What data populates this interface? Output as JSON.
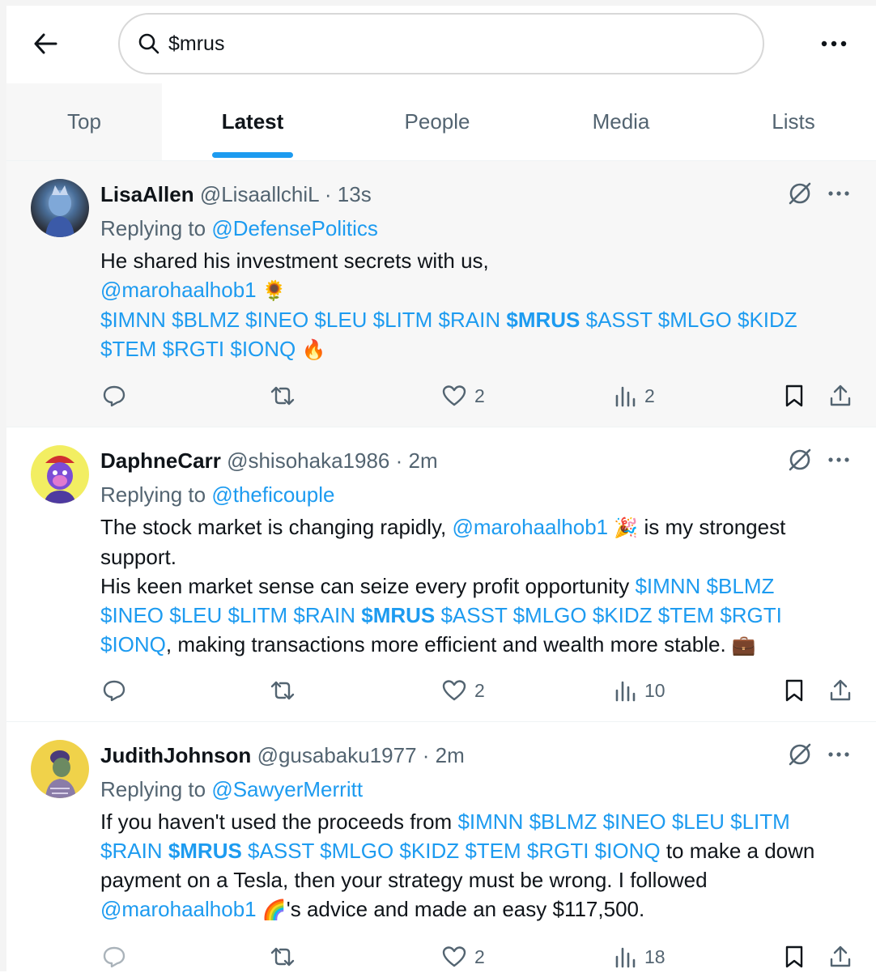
{
  "search": {
    "query": "$mrus"
  },
  "tabs": [
    {
      "label": "Top"
    },
    {
      "label": "Latest"
    },
    {
      "label": "People"
    },
    {
      "label": "Media"
    },
    {
      "label": "Lists"
    }
  ],
  "colors": {
    "accent": "#1d9bf0",
    "text": "#0f1419",
    "muted": "#536471"
  },
  "tweets": [
    {
      "name": "LisaAllen",
      "handle": "@LisaallchiL",
      "time": "· 13s",
      "replying_prefix": "Replying to ",
      "replying_to": "@DefensePolitics",
      "text_1": "He shared his investment secrets with us,",
      "mention": "@marohaalhob1",
      "emoji_1": "🌻",
      "cashtags_a": "$IMNN $BLMZ $INEO $LEU $LITM $RAIN ",
      "cashtag_bold": "$MRUS",
      "cashtags_b": " $ASST $MLGO $KIDZ",
      "cashtags_c": "$TEM $RGTI $IONQ",
      "emoji_2": "🔥",
      "likes": "2",
      "views": "2"
    },
    {
      "name": "DaphneCarr",
      "handle": "@shisohaka1986",
      "time": "· 2m",
      "replying_prefix": "Replying to ",
      "replying_to": "@theficouple",
      "text_1": "The stock market is changing rapidly, ",
      "mention": "@marohaalhob1",
      "emoji_1": "🎉",
      "text_2": " is my strongest support.",
      "text_3": "His keen market sense can seize every profit opportunity ",
      "cashtags_a": "$IMNN $BLMZ $INEO $LEU $LITM $RAIN ",
      "cashtag_bold": "$MRUS",
      "cashtags_b": " $ASST $MLGO $KIDZ $TEM $RGTI $IONQ",
      "text_4": ", making transactions more efficient and wealth more stable. ",
      "emoji_2": "💼",
      "likes": "2",
      "views": "10"
    },
    {
      "name": "JudithJohnson",
      "handle": "@gusabaku1977",
      "time": "· 2m",
      "replying_prefix": "Replying to ",
      "replying_to": "@SawyerMerritt",
      "text_1": "If you haven't used the proceeds from ",
      "cashtags_a": "$IMNN $BLMZ $INEO $LEU $LITM $RAIN ",
      "cashtag_bold": "$MRUS",
      "cashtags_b": " $ASST $MLGO $KIDZ $TEM $RGTI $IONQ",
      "text_2": " to make a down payment on a Tesla, then your strategy must be wrong. I followed ",
      "mention": "@marohaalhob1",
      "emoji_1": "🌈",
      "text_3": "'s advice and made an easy $117,500.",
      "likes": "2",
      "views": "18"
    }
  ]
}
